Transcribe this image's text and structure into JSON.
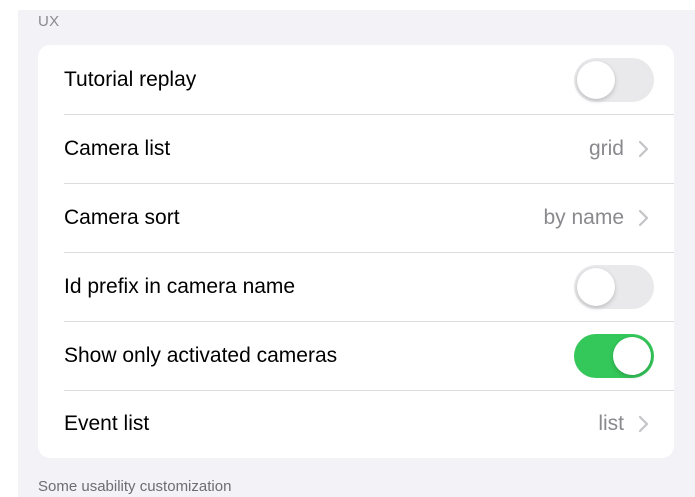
{
  "section": {
    "header": "UX",
    "footer": "Some usability customization"
  },
  "colors": {
    "toggle_on": "#34c759",
    "toggle_off": "#e9e9eb",
    "grouped_background": "#f2f2f7",
    "secondary_text": "#8a8a8e"
  },
  "rows": [
    {
      "label": "Tutorial replay",
      "type": "toggle",
      "on": false
    },
    {
      "label": "Camera list",
      "type": "disclosure",
      "value": "grid",
      "icon": "chevron-right-icon"
    },
    {
      "label": "Camera sort",
      "type": "disclosure",
      "value": "by name",
      "icon": "chevron-right-icon"
    },
    {
      "label": "Id prefix in camera name",
      "type": "toggle",
      "on": false
    },
    {
      "label": "Show only activated cameras",
      "type": "toggle",
      "on": true
    },
    {
      "label": "Event list",
      "type": "disclosure",
      "value": "list",
      "icon": "chevron-right-icon"
    }
  ]
}
